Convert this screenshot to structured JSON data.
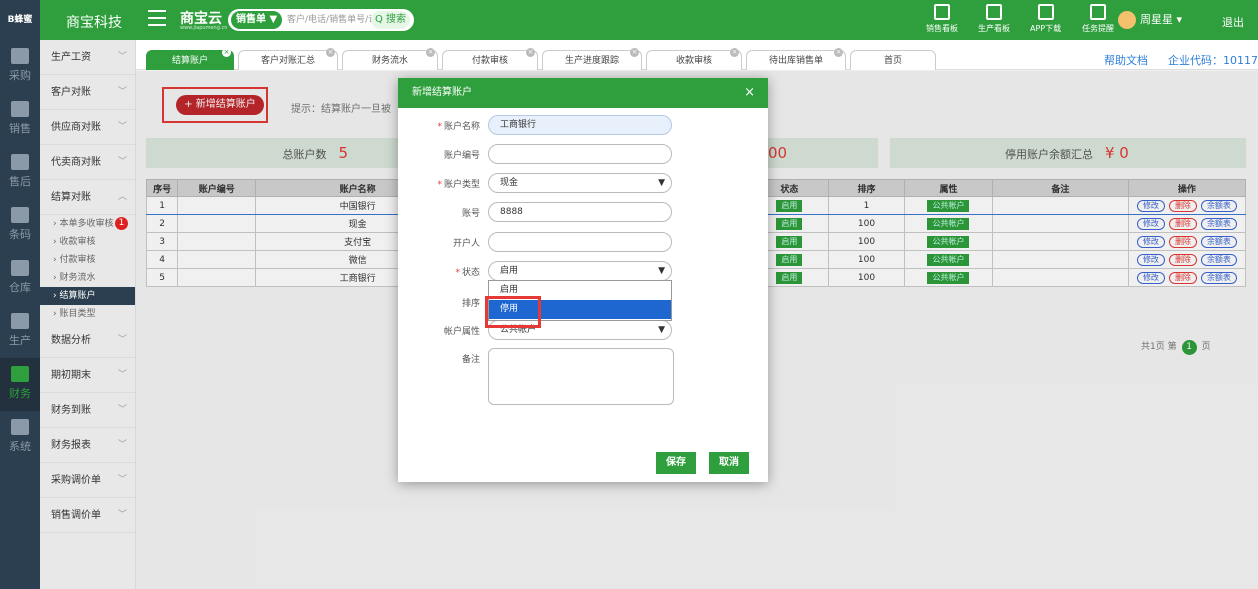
{
  "header": {
    "logo": "B蜂蜜",
    "brand": "商宝科技",
    "yun_title": "商宝云",
    "yun_sub": "www.jiapumeng.cn",
    "search_select": "销售单 ▼",
    "search_placeholder": "客户/电话/销售单号/订单号",
    "search_button": "Q 搜索",
    "tools": [
      "销售看板",
      "生产看板",
      "APP下载",
      "任务提醒"
    ],
    "user": "周星星 ▾",
    "logout": "退出",
    "brand_color": "#2e9f3c"
  },
  "left_rail": [
    "采购",
    "销售",
    "售后",
    "条码",
    "仓库",
    "生产",
    "财务",
    "系统"
  ],
  "nav": {
    "groups_top": [
      "生产工资",
      "客户对账",
      "供应商对账",
      "代卖商对账",
      "结算对账"
    ],
    "subs": [
      "本单多收审核",
      "收款审核",
      "付款审核",
      "财务流水",
      "结算账户",
      "账目类型"
    ],
    "badge": "1",
    "groups_bottom": [
      "数据分析",
      "期初期末",
      "财务到账",
      "财务报表",
      "采购调价单",
      "销售调价单"
    ]
  },
  "tabs": [
    "结算账户",
    "客户对账汇总",
    "财务流水",
    "付款审核",
    "生产进度跟踪",
    "收款审核",
    "待出库销售单",
    "首页"
  ],
  "help": "帮助文档",
  "corp_code": "企业代码：10117",
  "main": {
    "add_button": "+ 新增结算账户",
    "tip": "提示：结算账户一旦被",
    "total_label": "总账户数",
    "total_value": "5",
    "mid_value": "00",
    "disabled_label": "停用账户余额汇总",
    "disabled_value": "¥ 0"
  },
  "table": {
    "headers": [
      "序号",
      "账户编号",
      "账户名称",
      "状态",
      "排序",
      "属性",
      "备注",
      "操作"
    ],
    "rows": [
      [
        "1",
        "",
        "中国银行",
        "启用",
        "1",
        "公共帐户",
        ""
      ],
      [
        "2",
        "",
        "现金",
        "启用",
        "100",
        "公共帐户",
        ""
      ],
      [
        "3",
        "",
        "支付宝",
        "启用",
        "100",
        "公共帐户",
        ""
      ],
      [
        "4",
        "",
        "微信",
        "启用",
        "100",
        "公共帐户",
        ""
      ],
      [
        "5",
        "",
        "工商银行",
        "启用",
        "100",
        "公共帐户",
        ""
      ]
    ],
    "ops": [
      "修改",
      "删除",
      "余额表"
    ]
  },
  "pager": {
    "prefix": "共1页 第",
    "page": "1",
    "suffix": "页"
  },
  "modal": {
    "title": "新增结算账户",
    "close": "×",
    "fields": {
      "name_label": "账户名称",
      "name_value": "工商银行",
      "code_label": "账户编号",
      "code_value": "",
      "type_label": "账户类型",
      "type_value": "现金",
      "account_label": "账号",
      "account_value": "8888",
      "holder_label": "开户人",
      "holder_value": "",
      "status_label": "状态",
      "status_value": "启用",
      "sort_label": "排序",
      "attr_label": "帐户属性",
      "attr_value": "公共帐户",
      "note_label": "备注"
    },
    "status_options": [
      "启用",
      "停用"
    ],
    "save": "保存",
    "cancel": "取消"
  }
}
